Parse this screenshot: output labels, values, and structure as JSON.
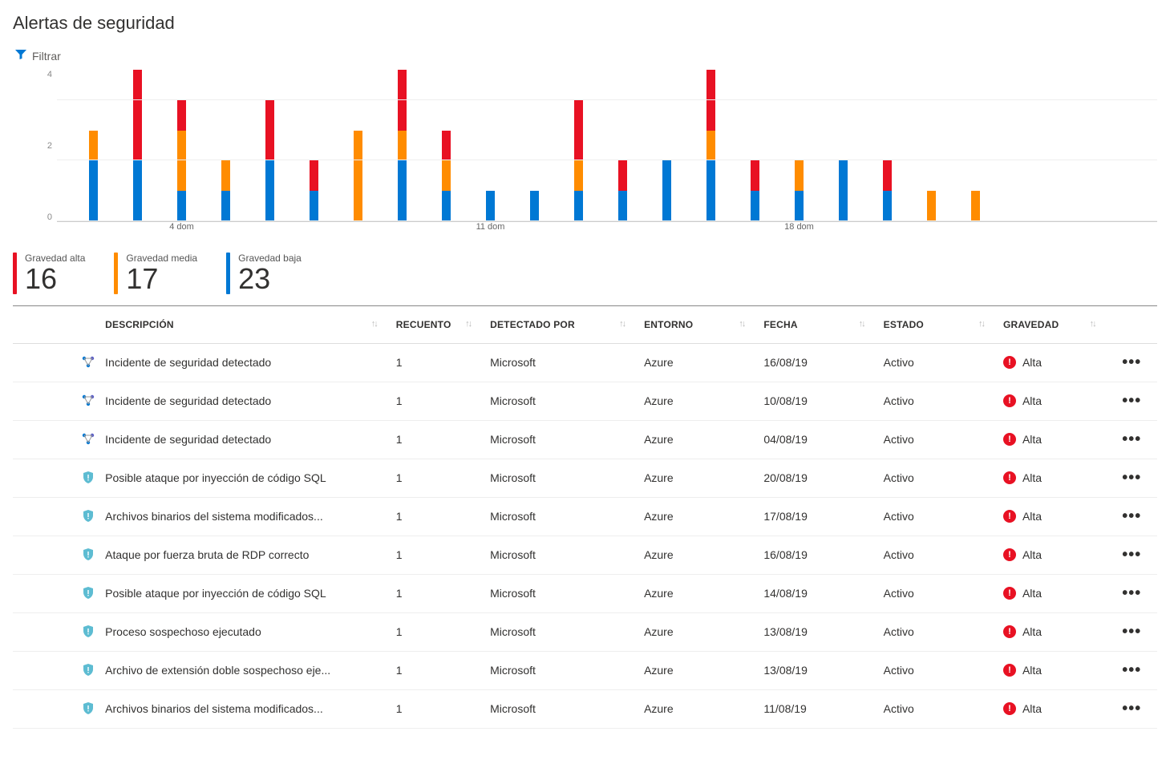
{
  "page_title": "Alertas de seguridad",
  "filter_label": "Filtrar",
  "chart_data": {
    "type": "bar",
    "ylabel": "",
    "ylim": [
      0,
      5
    ],
    "yticks": [
      0,
      2,
      4
    ],
    "xlabels": [
      {
        "index": 2,
        "text": "4 dom"
      },
      {
        "index": 9,
        "text": "11 dom"
      },
      {
        "index": 16,
        "text": "18 dom"
      }
    ],
    "series_names": [
      "Gravedad alta",
      "Gravedad media",
      "Gravedad baja"
    ],
    "bars": [
      {
        "high": 0,
        "medium": 1,
        "low": 2
      },
      {
        "high": 3,
        "medium": 0,
        "low": 2
      },
      {
        "high": 1,
        "medium": 2,
        "low": 1
      },
      {
        "high": 0,
        "medium": 1,
        "low": 1
      },
      {
        "high": 2,
        "medium": 0,
        "low": 2
      },
      {
        "high": 1,
        "medium": 0,
        "low": 1
      },
      {
        "high": 0,
        "medium": 3,
        "low": 0
      },
      {
        "high": 2,
        "medium": 1,
        "low": 2
      },
      {
        "high": 1,
        "medium": 1,
        "low": 1
      },
      {
        "high": 0,
        "medium": 0,
        "low": 1
      },
      {
        "high": 0,
        "medium": 0,
        "low": 1
      },
      {
        "high": 2,
        "medium": 1,
        "low": 1
      },
      {
        "high": 1,
        "medium": 0,
        "low": 1
      },
      {
        "high": 0,
        "medium": 0,
        "low": 2
      },
      {
        "high": 2,
        "medium": 1,
        "low": 2
      },
      {
        "high": 1,
        "medium": 0,
        "low": 1
      },
      {
        "high": 0,
        "medium": 1,
        "low": 1
      },
      {
        "high": 0,
        "medium": 0,
        "low": 2
      },
      {
        "high": 1,
        "medium": 0,
        "low": 1
      },
      {
        "high": 0,
        "medium": 1,
        "low": 0
      },
      {
        "high": 0,
        "medium": 1,
        "low": 0
      }
    ]
  },
  "summary": [
    {
      "label": "Gravedad alta",
      "value": "16",
      "class": "high"
    },
    {
      "label": "Gravedad media",
      "value": "17",
      "class": "medium"
    },
    {
      "label": "Gravedad baja",
      "value": "23",
      "class": "low"
    }
  ],
  "columns": {
    "descripcion": "Descripción",
    "recuento": "Recuento",
    "detectado_por": "Detectado por",
    "entorno": "Entorno",
    "fecha": "Fecha",
    "estado": "Estado",
    "gravedad": "Gravedad"
  },
  "rows": [
    {
      "icon": "incident",
      "descripcion": "Incidente de seguridad detectado",
      "recuento": "1",
      "detectado_por": "Microsoft",
      "entorno": "Azure",
      "fecha": "16/08/19",
      "estado": "Activo",
      "gravedad": "Alta"
    },
    {
      "icon": "incident",
      "descripcion": "Incidente de seguridad detectado",
      "recuento": "1",
      "detectado_por": "Microsoft",
      "entorno": "Azure",
      "fecha": "10/08/19",
      "estado": "Activo",
      "gravedad": "Alta"
    },
    {
      "icon": "incident",
      "descripcion": "Incidente de seguridad detectado",
      "recuento": "1",
      "detectado_por": "Microsoft",
      "entorno": "Azure",
      "fecha": "04/08/19",
      "estado": "Activo",
      "gravedad": "Alta"
    },
    {
      "icon": "shield",
      "descripcion": "Posible ataque por inyección de código SQL",
      "recuento": "1",
      "detectado_por": "Microsoft",
      "entorno": "Azure",
      "fecha": "20/08/19",
      "estado": "Activo",
      "gravedad": "Alta"
    },
    {
      "icon": "shield",
      "descripcion": "Archivos binarios del sistema modificados...",
      "recuento": "1",
      "detectado_por": "Microsoft",
      "entorno": "Azure",
      "fecha": "17/08/19",
      "estado": "Activo",
      "gravedad": "Alta"
    },
    {
      "icon": "shield",
      "descripcion": "Ataque por fuerza bruta de RDP correcto",
      "recuento": "1",
      "detectado_por": "Microsoft",
      "entorno": "Azure",
      "fecha": "16/08/19",
      "estado": "Activo",
      "gravedad": "Alta"
    },
    {
      "icon": "shield",
      "descripcion": "Posible ataque por inyección de código SQL",
      "recuento": "1",
      "detectado_por": "Microsoft",
      "entorno": "Azure",
      "fecha": "14/08/19",
      "estado": "Activo",
      "gravedad": "Alta"
    },
    {
      "icon": "shield",
      "descripcion": "Proceso sospechoso ejecutado",
      "recuento": "1",
      "detectado_por": "Microsoft",
      "entorno": "Azure",
      "fecha": "13/08/19",
      "estado": "Activo",
      "gravedad": "Alta"
    },
    {
      "icon": "shield",
      "descripcion": "Archivo de extensión doble sospechoso eje...",
      "recuento": "1",
      "detectado_por": "Microsoft",
      "entorno": "Azure",
      "fecha": "13/08/19",
      "estado": "Activo",
      "gravedad": "Alta"
    },
    {
      "icon": "shield",
      "descripcion": "Archivos binarios del sistema modificados...",
      "recuento": "1",
      "detectado_por": "Microsoft",
      "entorno": "Azure",
      "fecha": "11/08/19",
      "estado": "Activo",
      "gravedad": "Alta"
    }
  ]
}
